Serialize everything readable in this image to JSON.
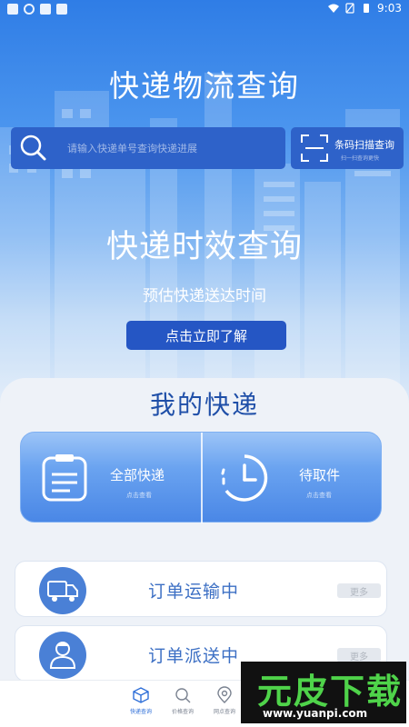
{
  "status_bar": {
    "time": "9:03"
  },
  "header": {
    "title": "快递物流查询"
  },
  "search": {
    "placeholder": "请输入快递单号查询快递进展",
    "scan_label": "条码扫描查询",
    "scan_sub": "扫一扫查询更快"
  },
  "banner": {
    "title": "快递时效查询",
    "subtitle": "预估快递送达时间",
    "button": "点击立即了解"
  },
  "my_express": {
    "title": "我的快递",
    "stats": [
      {
        "label": "全部快递",
        "sub": "点击查看",
        "icon": "clipboard-icon"
      },
      {
        "label": "待取件",
        "sub": "点击查看",
        "icon": "clock-icon"
      }
    ],
    "orders": [
      {
        "label": "订单运输中",
        "more": "更多",
        "icon": "truck-icon"
      },
      {
        "label": "订单派送中",
        "more": "更多",
        "icon": "courier-icon"
      }
    ]
  },
  "tabbar": {
    "items": [
      {
        "label": "快递查询",
        "icon": "package-icon",
        "active": true
      },
      {
        "label": "价格查询",
        "icon": "price-icon",
        "active": false
      },
      {
        "label": "网点查询",
        "icon": "location-icon",
        "active": false
      }
    ]
  },
  "watermark": {
    "text": "元皮下载",
    "url": "www.yuanpi.com"
  },
  "colors": {
    "primary": "#2e62c9",
    "accent": "#4a87e6",
    "title_blue": "#1f4fa8"
  }
}
